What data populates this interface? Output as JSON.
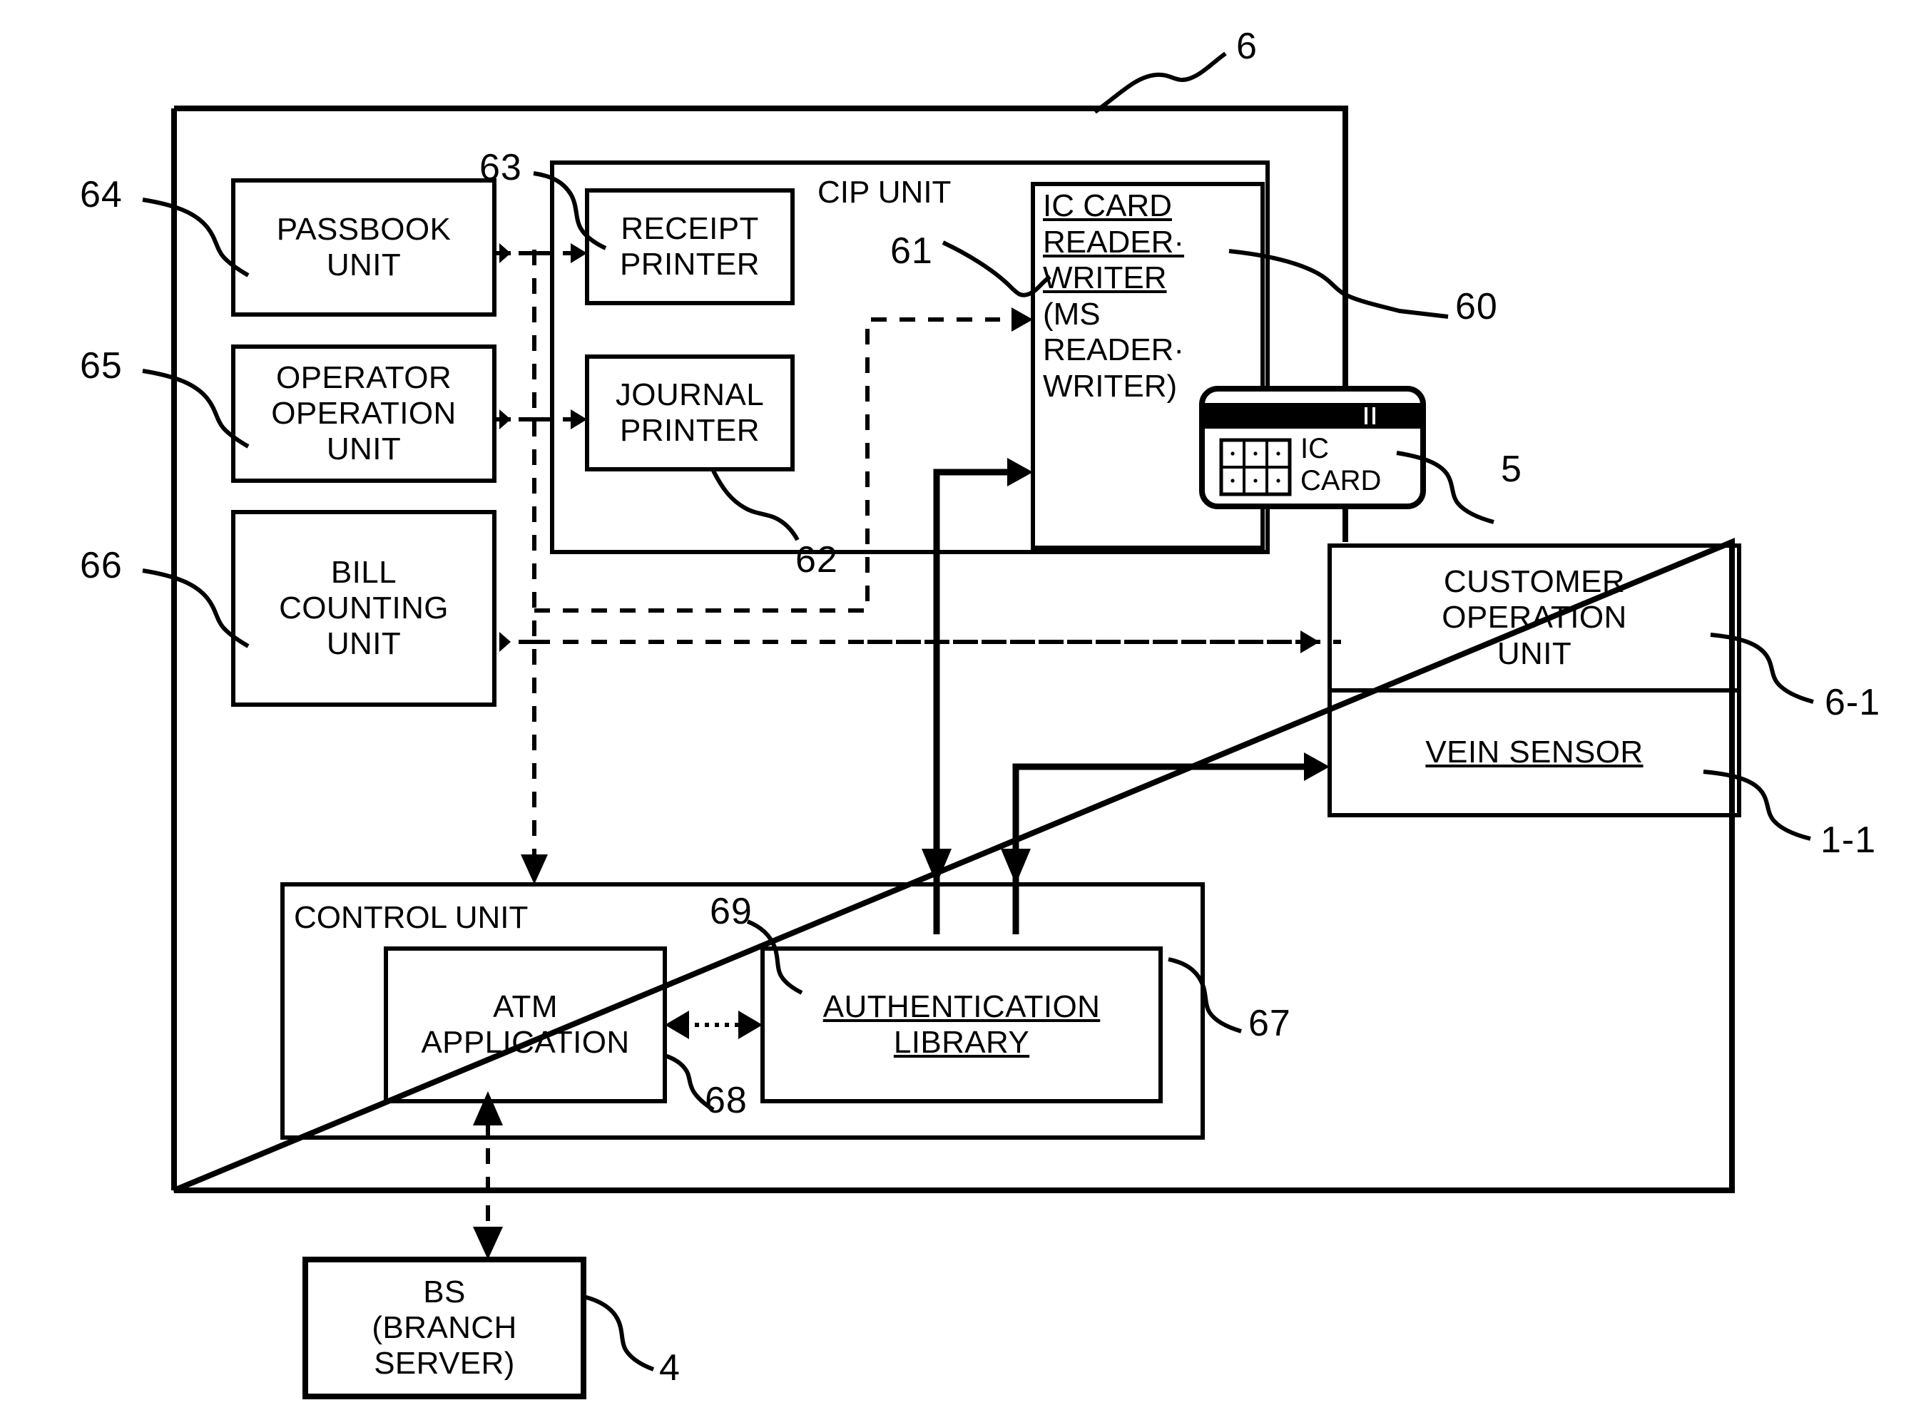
{
  "figure": {
    "title": "ATM block diagram",
    "ink_color": "#000000",
    "background_color": "#ffffff"
  },
  "outer_unit": {
    "ref": "6"
  },
  "left_column": [
    {
      "label": "PASSBOOK\nUNIT",
      "ref": "64"
    },
    {
      "label": "OPERATOR\nOPERATION\nUNIT",
      "ref": "65"
    },
    {
      "label": "BILL\nCOUNTING\nUNIT",
      "ref": "66"
    }
  ],
  "cip_unit": {
    "title": "CIP UNIT",
    "children": [
      {
        "label": "RECEIPT\nPRINTER",
        "ref": "63"
      },
      {
        "label": "JOURNAL\nPRINTER",
        "ref": "62"
      },
      {
        "label_line1": "IC CARD",
        "label_line2": "READER·",
        "label_line3": "WRITER",
        "label_line4": "(MS",
        "label_line5": "READER·",
        "label_line6": "WRITER)",
        "ref_inner": "61",
        "ref_outer": "60"
      }
    ]
  },
  "ic_card": {
    "label": "IC\nCARD",
    "ref": "5"
  },
  "right_column": [
    {
      "label": "CUSTOMER\nOPERATION\nUNIT",
      "ref": "6-1",
      "underline": false
    },
    {
      "label": "VEIN SENSOR",
      "ref": "1-1",
      "underline": true
    }
  ],
  "control_unit": {
    "title": "CONTROL UNIT",
    "ref": "67",
    "children": [
      {
        "label": "ATM\nAPPLICATION",
        "ref": "68",
        "underline": false
      },
      {
        "label": "AUTHENTICATION\nLIBRARY",
        "ref": "69",
        "underline": true
      }
    ]
  },
  "branch_server": {
    "label": "BS\n(BRANCH\nSERVER)",
    "ref": "4"
  }
}
